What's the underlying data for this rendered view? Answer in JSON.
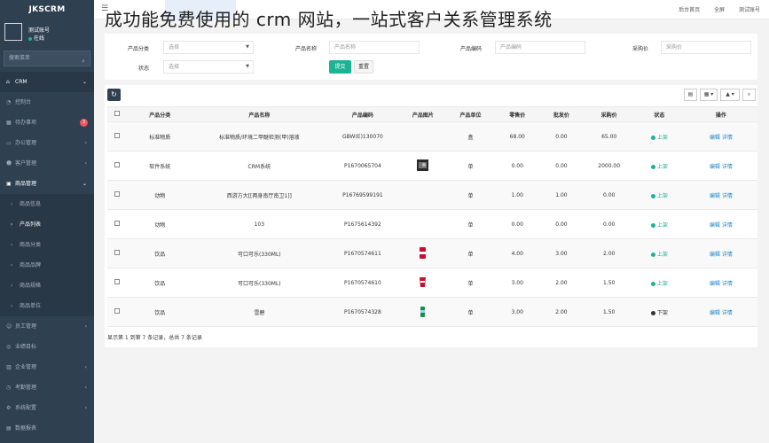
{
  "brand": "JKSCRM",
  "overlay_title": "成功能免费使用的 crm 网站，一站式客户关系管理系统",
  "profile": {
    "name": "测试账号",
    "status": "在线"
  },
  "sidebar_search": {
    "placeholder": "搜索菜单"
  },
  "nav": [
    {
      "label": "CRM",
      "icon": "home-icon",
      "caret": "⌄",
      "type": "top"
    },
    {
      "label": "控制台",
      "icon": "dashboard-icon",
      "caret": "",
      "type": "item"
    },
    {
      "label": "待办事项",
      "icon": "calendar-icon",
      "caret": "",
      "badge": "3",
      "type": "item"
    },
    {
      "label": "办公管理",
      "icon": "briefcase-icon",
      "caret": "‹",
      "type": "item"
    },
    {
      "label": "客户管理",
      "icon": "users-icon",
      "caret": "‹",
      "type": "item"
    },
    {
      "label": "商品管理",
      "icon": "box-icon",
      "caret": "⌄",
      "type": "group"
    },
    {
      "label": "商品信息",
      "icon": "",
      "caret": "",
      "type": "sub"
    },
    {
      "label": "产品列表",
      "icon": "",
      "caret": "",
      "type": "sub-current"
    },
    {
      "label": "商品分类",
      "icon": "",
      "caret": "",
      "type": "sub"
    },
    {
      "label": "商品品牌",
      "icon": "",
      "caret": "",
      "type": "sub"
    },
    {
      "label": "商品规格",
      "icon": "",
      "caret": "",
      "type": "sub"
    },
    {
      "label": "商品单位",
      "icon": "",
      "caret": "",
      "type": "sub"
    },
    {
      "label": "员工管理",
      "icon": "user-icon",
      "caret": "‹",
      "type": "item"
    },
    {
      "label": "业绩目标",
      "icon": "target-icon",
      "caret": "",
      "type": "item"
    },
    {
      "label": "企业管理",
      "icon": "building-icon",
      "caret": "‹",
      "type": "item"
    },
    {
      "label": "考勤管理",
      "icon": "clock-icon",
      "caret": "‹",
      "type": "item"
    },
    {
      "label": "系统配置",
      "icon": "gear-icon",
      "caret": "‹",
      "type": "item"
    },
    {
      "label": "数据报表",
      "icon": "chart-icon",
      "caret": "",
      "type": "item"
    },
    {
      "label": "常规管理",
      "icon": "folder-icon",
      "caret": "",
      "badge_new": "new",
      "type": "item"
    }
  ],
  "topbar": {
    "right": [
      "后台首页",
      "全屏",
      "测试账号"
    ]
  },
  "filters": {
    "category_label": "产品分类",
    "category_value": "选择",
    "name_label": "产品名称",
    "name_placeholder": "产品名称",
    "code_label": "产品编码",
    "code_placeholder": "产品编码",
    "price_label": "采购价",
    "price_placeholder": "采购价",
    "status_label": "状态",
    "status_value": "选择",
    "search_btn": "提交",
    "reset_btn": "重置"
  },
  "table": {
    "headers": [
      "产品分类",
      "产品名称",
      "产品编码",
      "产品图片",
      "产品单位",
      "零售价",
      "批发价",
      "采购价",
      "状态",
      "操作"
    ],
    "rows": [
      {
        "cat": "标准物质",
        "name": "标准物质/环境二甲醚检测(甲)溶液",
        "code": "GBW(E)130070",
        "img": "",
        "unit": "盒",
        "retail": "68.00",
        "whole": "0.00",
        "buy": "65.00",
        "status": "上架",
        "on": true
      },
      {
        "cat": "软件系统",
        "name": "CRM系统",
        "code": "P1670065704",
        "img": "photo",
        "unit": "单",
        "retail": "0.00",
        "whole": "0.00",
        "buy": "2000.00",
        "status": "上架",
        "on": true
      },
      {
        "cat": "动物",
        "name": "西游方大[[两身南厅南卫1]]",
        "code": "P16769599191",
        "img": "",
        "unit": "单",
        "retail": "1.00",
        "whole": "1.00",
        "buy": "0.00",
        "status": "上架",
        "on": true
      },
      {
        "cat": "动物",
        "name": "103",
        "code": "P1675614392",
        "img": "",
        "unit": "单",
        "retail": "0.00",
        "whole": "0.00",
        "buy": "0.00",
        "status": "上架",
        "on": true
      },
      {
        "cat": "饮品",
        "name": "可口可乐(330ML)",
        "code": "P1670574611",
        "img": "can-red",
        "unit": "单",
        "retail": "4.00",
        "whole": "3.00",
        "buy": "2.00",
        "status": "上架",
        "on": true
      },
      {
        "cat": "饮品",
        "name": "可口可乐(330ML)",
        "code": "P1670574610",
        "img": "cup-red",
        "unit": "单",
        "retail": "3.00",
        "whole": "2.00",
        "buy": "1.50",
        "status": "上架",
        "on": true
      },
      {
        "cat": "饮品",
        "name": "雪碧",
        "code": "P1670574328",
        "img": "bottle-green",
        "unit": "单",
        "retail": "3.00",
        "whole": "2.00",
        "buy": "1.50",
        "status": "下架",
        "on": false
      }
    ],
    "ops": [
      "编辑",
      "详情"
    ],
    "pager": "显示第 1 到第 7 条记录，总共 7 条记录",
    "colors": {
      "on": "#1ab394",
      "off": "#333333"
    }
  }
}
